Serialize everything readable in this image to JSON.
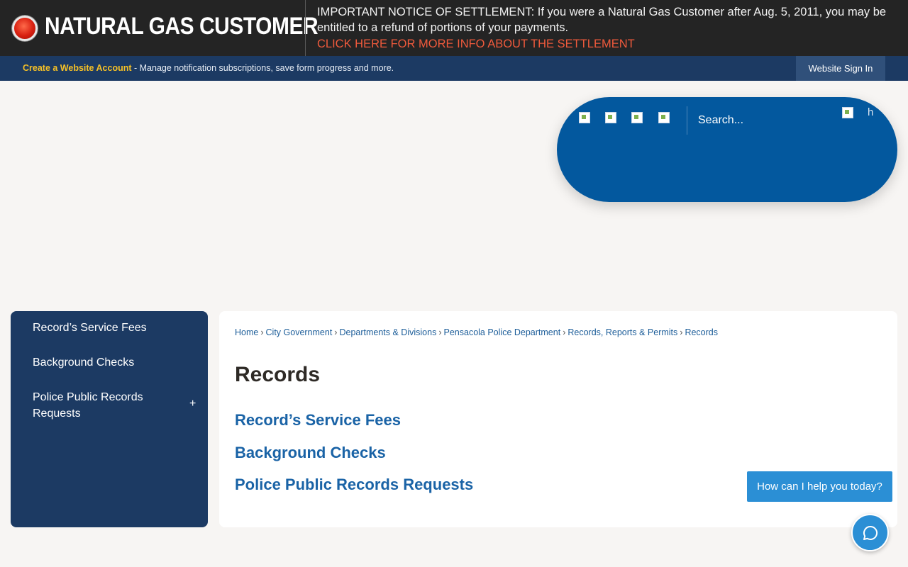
{
  "alert": {
    "title": "NATURAL GAS CUSTOMER",
    "message": "IMPORTANT NOTICE OF SETTLEMENT: If you were a Natural Gas Customer after Aug. 5, 2011, you may be entitled to a refund of portions of your payments.",
    "link": "CLICK HERE FOR MORE INFO ABOUT THE SETTLEMENT",
    "icon": "alert-icon"
  },
  "account_bar": {
    "create_label": "Create a Website Account",
    "description": " - Manage notification subscriptions, save form progress and more.",
    "signin_label": "Website Sign In"
  },
  "search": {
    "placeholder": "Search...",
    "button_alt": "Search",
    "quick_icons": [
      "broken-image-icon",
      "broken-image-icon",
      "broken-image-icon",
      "broken-image-icon"
    ]
  },
  "sidebar": {
    "items": [
      {
        "label": "Record’s Service Fees"
      },
      {
        "label": "Background Checks"
      },
      {
        "label": "Police Public Records Requests",
        "toggle": "+"
      }
    ]
  },
  "breadcrumb": [
    "Home",
    "City Government",
    "Departments & Divisions",
    "Pensacola Police Department",
    "Records, Reports & Permits",
    "Records"
  ],
  "page": {
    "title": "Records",
    "links": [
      "Record’s Service Fees",
      "Background Checks",
      "Police Public Records Requests"
    ]
  },
  "chat": {
    "prompt": "How can I help you today?",
    "icon": "chat-bubble-icon"
  },
  "colors": {
    "alert_bg": "#242424",
    "alert_link": "#f05a3c",
    "nav_blue": "#1c3a63",
    "search_blue": "#03589e",
    "link_blue": "#1a63a6",
    "accent_yellow": "#f5c026",
    "chat_blue": "#2b8fd5"
  }
}
